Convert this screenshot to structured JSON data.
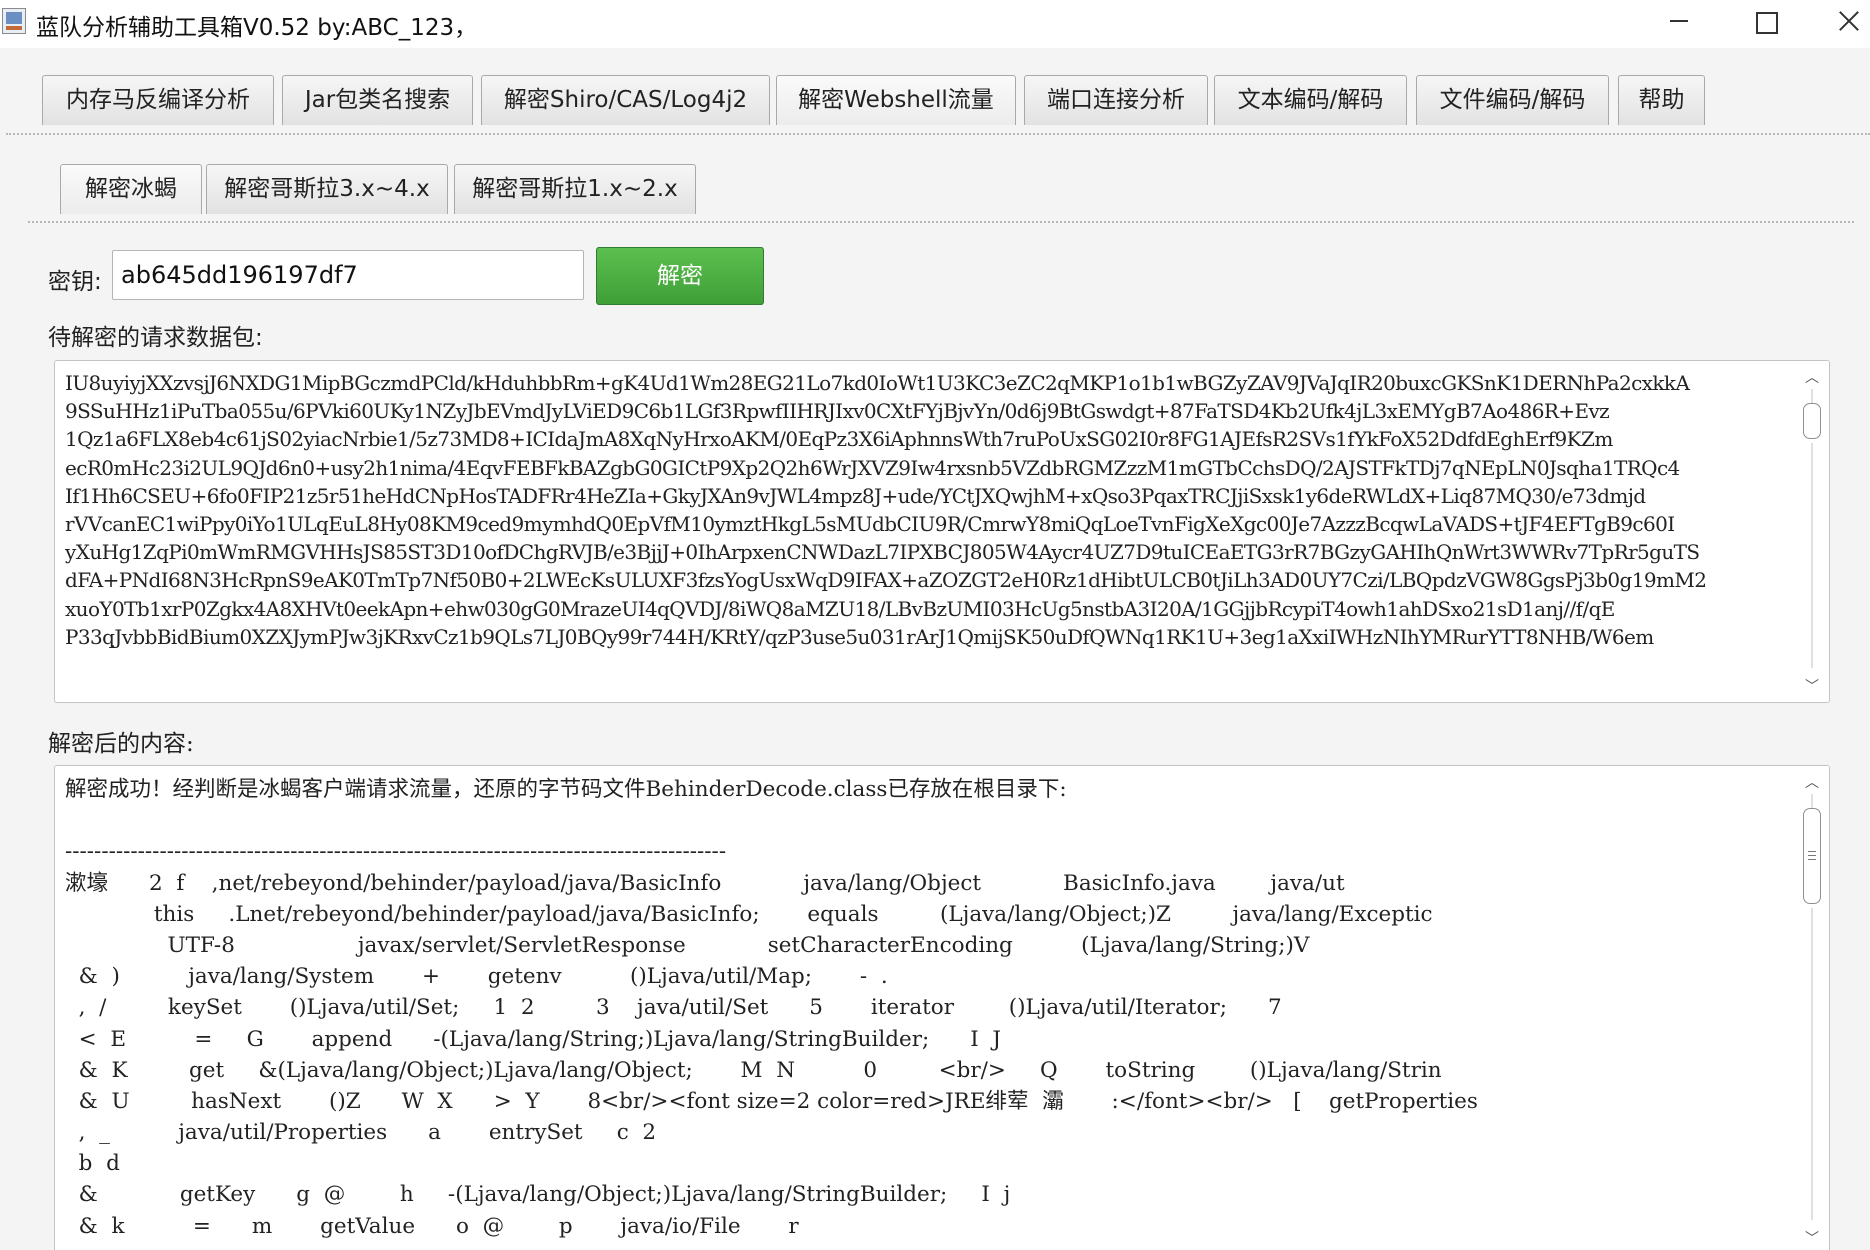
{
  "window": {
    "title": "蓝队分析辅助工具箱V0.52 by:ABC_123，"
  },
  "main_tabs": [
    {
      "label": "内存马反编译分析"
    },
    {
      "label": "Jar包类名搜索"
    },
    {
      "label": "解密Shiro/CAS/Log4j2"
    },
    {
      "label": "解密Webshell流量"
    },
    {
      "label": "端口连接分析"
    },
    {
      "label": "文本编码/解码"
    },
    {
      "label": "文件编码/解码"
    },
    {
      "label": "帮助"
    }
  ],
  "sub_tabs": [
    {
      "label": "解密冰蝎"
    },
    {
      "label": "解密哥斯拉3.x~4.x"
    },
    {
      "label": "解密哥斯拉1.x~2.x"
    }
  ],
  "key": {
    "label": "密钥:",
    "value": "ab645dd196197df7"
  },
  "decrypt_button": "解密",
  "request": {
    "label": "待解密的请求数据包:",
    "lines": [
      "IU8uyiyjXXzvsjJ6NXDG1MipBGczmdPCld/kHduhbbRm+gK4Ud1Wm28EG21Lo7kd0IoWt1U3KC3eZC2qMKP1o1b1wBGZyZAV9JVaJqIR20buxcGKSnK1DERNhPa2cxkkA",
      "9SSuHHz1iPuTba055u/6PVki60UKy1NZyJbEVmdJyLViED9C6b1LGf3RpwfIIHRJIxv0CXtFYjBjvYn/0d6j9BtGswdgt+87FaTSD4Kb2Ufk4jL3xEMYgB7Ao486R+Evz",
      "1Qz1a6FLX8eb4c61jS02yiacNrbie1/5z73MD8+ICIdaJmA8XqNyHrxoAKM/0EqPz3X6iAphnnsWth7ruPoUxSG02I0r8FG1AJEfsR2SVs1fYkFoX52DdfdEghErf9KZm",
      "ecR0mHc23i2UL9QJd6n0+usy2h1nima/4EqvFEBFkBAZgbG0GICtP9Xp2Q2h6WrJXVZ9Iw4rxsnb5VZdbRGMZzzM1mGTbCchsDQ/2AJSTFkTDj7qNEpLN0Jsqha1TRQc4",
      "If1Hh6CSEU+6fo0FIP21z5r51heHdCNpHosTADFRr4HeZIa+GkyJXAn9vJWL4mpz8J+ude/YCtJXQwjhM+xQso3PqaxTRCJjiSxsk1y6deRWLdX+Liq87MQ30/e73dmjd",
      "rVVcanEC1wiPpy0iYo1ULqEuL8Hy08KM9ced9mymhdQ0EpVfM10ymztHkgL5sMUdbCIU9R/CmrwY8miQqLoeTvnFigXeXgc00Je7AzzzBcqwLaVADS+tJF4EFTgB9c60I",
      "yXuHg1ZqPi0mWmRMGVHHsJS85ST3D10ofDChgRVJB/e3BjjJ+0IhArpxenCNWDazL7IPXBCJ805W4Aycr4UZ7D9tuICEaETG3rR7BGzyGAHIhQnWrt3WWRv7TpRr5guTS",
      "dFA+PNdI68N3HcRpnS9eAK0TmTp7Nf50B0+2LWEcKsULUXF3fzsYogUsxWqD9IFAX+aZOZGT2eH0Rz1dHibtULCB0tJiLh3AD0UY7Czi/LBQpdzVGW8GgsPj3b0g19mM2",
      "xuoY0Tb1xrP0Zgkx4A8XHVt0eekApn+ehw030gG0MrazeUI4qQVDJ/8iWQ8aMZU18/LBvBzUMI03HcUg5nstbA3I20A/1GGjjbRcypiT4owh1ahDSxo21sD1anj//f/qE",
      "P33qJvbbBidBium0XZXJymPJw3jKRxvCz1b9QLs7LJ0BQy99r744H/KRtY/qzP3use5u031rArJ1QmijSK50uDfQWNq1RK1U+3eg1aXxiIWHzNIhYMRurYTT8NHB/W6em"
    ]
  },
  "response": {
    "label": "解密后的内容:",
    "lines": [
      "解密成功！经判断是冰蝎客户端请求流量，还原的字节码文件BehinderDecode.class已存放在根目录下:",
      "",
      "-------------------------------------------------------------------------------------------",
      "漱壕      2  f    ,net/rebeyond/behinder/payload/java/BasicInfo            java/lang/Object            BasicInfo.java        java/ut",
      "             this     .Lnet/rebeyond/behinder/payload/java/BasicInfo;       equals         (Ljava/lang/Object;)Z         java/lang/Exceptic",
      "               UTF-8                  javax/servlet/ServletResponse            setCharacterEncoding          (Ljava/lang/String;)V",
      "  &  )          java/lang/System       +       getenv          ()Ljava/util/Map;       -  .",
      "  ,  /         keySet       ()Ljava/util/Set;     1  2         3    java/util/Set      5       iterator        ()Ljava/util/Iterator;      7",
      "  <  E          =     G       append      -(Ljava/lang/String;)Ljava/lang/StringBuilder;      I  J",
      "  &  K         get     &(Ljava/lang/Object;)Ljava/lang/Object;       M  N          0         <br/>     Q       toString        ()Ljava/lang/Strin",
      "  &  U         hasNext       ()Z      W  X      >  Y       8<br/><font size=2 color=red>JRE绯荤  灞       :</font><br/>   [    getProperties",
      "  ,  _          java/util/Properties      a       entrySet     c  2",
      "  b  d",
      "  &            getKey      g  @        h     -(Ljava/lang/Object;)Ljava/lang/StringBuilder;     I  j",
      "  &  k          =      m       getValue      o  @        p       java/io/File       r"
    ]
  }
}
